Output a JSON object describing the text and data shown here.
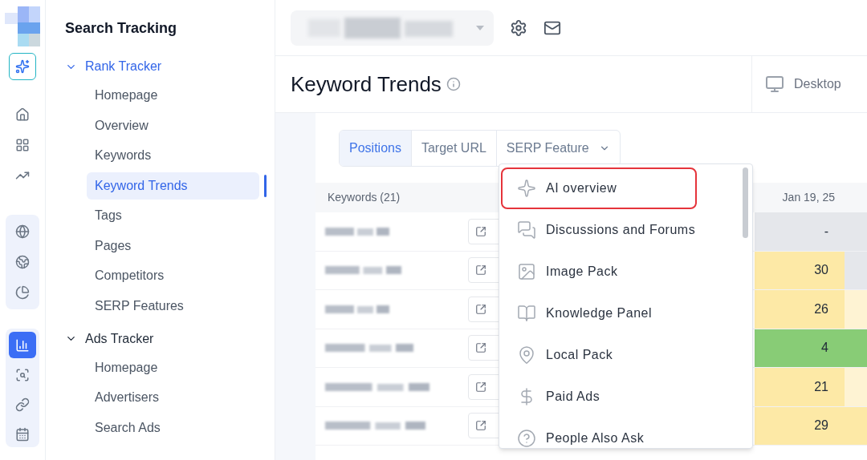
{
  "rail": {
    "items": [
      {
        "selected": false
      },
      {
        "selected": false
      },
      {
        "selected": false
      },
      {
        "selected": false
      },
      {
        "selected": false
      },
      {
        "selected": false
      },
      {
        "selected": false
      },
      {
        "selected": true
      },
      {
        "selected": false
      },
      {
        "selected": false
      },
      {
        "selected": false
      }
    ]
  },
  "sidebar": {
    "title": "Search Tracking",
    "groups": [
      {
        "label": "Rank Tracker",
        "expanded": true,
        "active": true,
        "items": [
          {
            "label": "Homepage",
            "selected": false
          },
          {
            "label": "Overview",
            "selected": false
          },
          {
            "label": "Keywords",
            "selected": false
          },
          {
            "label": "Keyword Trends",
            "selected": true
          },
          {
            "label": "Tags",
            "selected": false
          },
          {
            "label": "Pages",
            "selected": false
          },
          {
            "label": "Competitors",
            "selected": false
          },
          {
            "label": "SERP Features",
            "selected": false
          }
        ]
      },
      {
        "label": "Ads Tracker",
        "expanded": true,
        "active": false,
        "items": [
          {
            "label": "Homepage",
            "selected": false
          },
          {
            "label": "Advertisers",
            "selected": false
          },
          {
            "label": "Search Ads",
            "selected": false
          }
        ]
      }
    ]
  },
  "page": {
    "title": "Keyword Trends",
    "device": "Desktop"
  },
  "tabs": [
    {
      "label": "Positions",
      "selected": true,
      "kind": "tab"
    },
    {
      "label": "Target URL",
      "selected": false,
      "kind": "tab"
    },
    {
      "label": "SERP Feature",
      "selected": false,
      "kind": "dropdown"
    }
  ],
  "table": {
    "keywords_header": "Keywords (21)",
    "date_header": "Jan 19, 25",
    "rows": [
      {
        "cells": [
          {
            "value": "-",
            "color": "#e5e7eb"
          },
          {
            "color": "#e5e7eb"
          }
        ]
      },
      {
        "cells": [
          {
            "value": "30",
            "color": "#fde9a6"
          },
          {
            "color": "#e5e7eb"
          }
        ]
      },
      {
        "cells": [
          {
            "value": "26",
            "color": "#fde9a6"
          },
          {
            "color": "#fef3d3"
          }
        ]
      },
      {
        "cells": [
          {
            "value": "4",
            "color": "#88cc76"
          },
          {
            "color": "#88cc76"
          }
        ]
      },
      {
        "cells": [
          {
            "value": "21",
            "color": "#fde9a6"
          },
          {
            "color": "#fef3d3"
          }
        ]
      },
      {
        "cells": [
          {
            "value": "29",
            "color": "#fde9a6"
          },
          {
            "color": "#fde9a6"
          }
        ]
      }
    ]
  },
  "menu": {
    "items": [
      {
        "label": "AI overview",
        "highlighted": true
      },
      {
        "label": "Discussions and Forums",
        "highlighted": false
      },
      {
        "label": "Image Pack",
        "highlighted": false
      },
      {
        "label": "Knowledge Panel",
        "highlighted": false
      },
      {
        "label": "Local Pack",
        "highlighted": false
      },
      {
        "label": "Paid Ads",
        "highlighted": false
      },
      {
        "label": "People Also Ask",
        "highlighted": false
      }
    ]
  }
}
